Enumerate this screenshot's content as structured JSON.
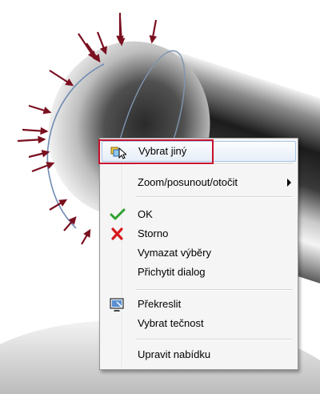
{
  "context_menu": {
    "items": [
      {
        "label": "Vybrat jiný",
        "icon": "select-other-icon"
      },
      {
        "label": "Zoom/posunout/otočit",
        "icon": "",
        "submenu": true
      },
      {
        "label": "OK",
        "icon": "green-check-icon"
      },
      {
        "label": "Storno",
        "icon": "red-x-icon"
      },
      {
        "label": "Vymazat výběry",
        "icon": ""
      },
      {
        "label": "Přichytit dialog",
        "icon": ""
      },
      {
        "label": "Překreslit",
        "icon": "redraw-icon"
      },
      {
        "label": "Vybrat tečnost",
        "icon": ""
      },
      {
        "label": "Upravit nabídku",
        "icon": ""
      }
    ]
  },
  "colors": {
    "highlight_frame": "#c8102e",
    "arrows": "#7a1020",
    "check": "#2ea12e",
    "cancel": "#d7191c"
  }
}
